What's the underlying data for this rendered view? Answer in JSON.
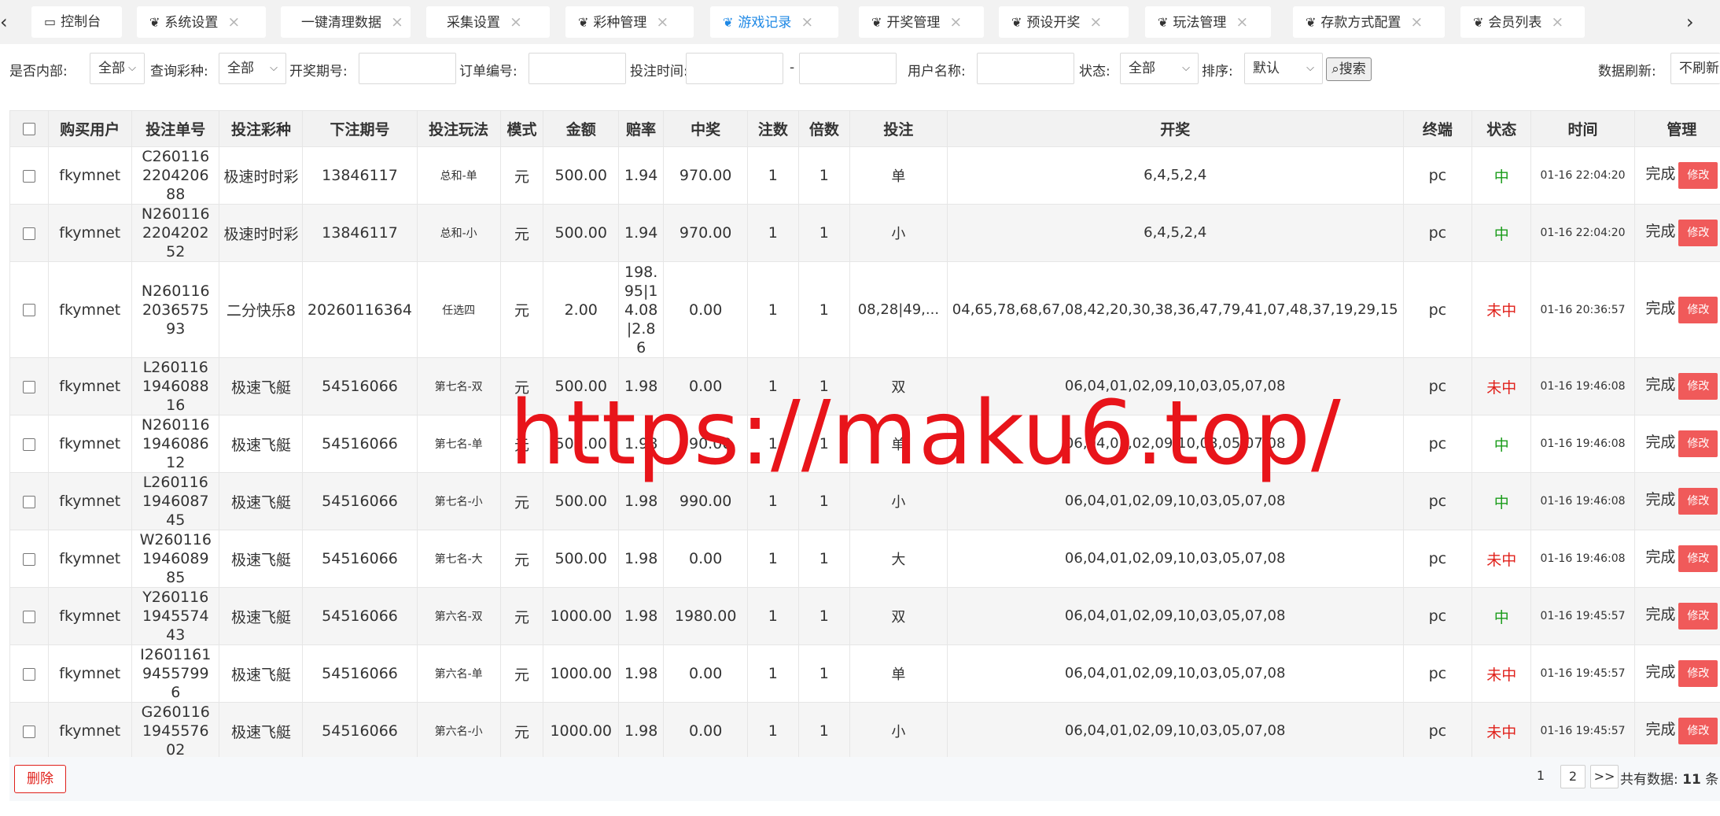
{
  "tabs": [
    {
      "label": "控制台",
      "icon": "monitor-icon",
      "active": false
    },
    {
      "label": "系统设置",
      "icon": "palm-icon",
      "active": false
    },
    {
      "label": "一键清理数据",
      "icon": "",
      "active": false
    },
    {
      "label": "采集设置",
      "icon": "",
      "active": false
    },
    {
      "label": "彩种管理",
      "icon": "palm-icon",
      "active": false
    },
    {
      "label": "游戏记录",
      "icon": "palm-icon",
      "active": true
    },
    {
      "label": "开奖管理",
      "icon": "palm-icon",
      "active": false
    },
    {
      "label": "预设开奖",
      "icon": "palm-icon",
      "active": false
    },
    {
      "label": "玩法管理",
      "icon": "palm-icon",
      "active": false
    },
    {
      "label": "存款方式配置",
      "icon": "palm-icon",
      "active": false
    },
    {
      "label": "会员列表",
      "icon": "palm-icon",
      "active": false
    }
  ],
  "filters": {
    "is_internal_label": "是否内部:",
    "is_internal_value": "全部",
    "lottery_label": "查询彩种:",
    "lottery_value": "全部",
    "period_label": "开奖期号:",
    "order_label": "订单编号:",
    "time_label": "投注时间:",
    "time_sep": "-",
    "user_label": "用户名称:",
    "status_label": "状态:",
    "status_value": "全部",
    "sort_label": "排序:",
    "sort_value": "默认",
    "search_button": "搜索",
    "refresh_label": "数据刷新:",
    "refresh_value": "不刷新"
  },
  "table": {
    "headers": [
      "购买用户",
      "投注单号",
      "投注彩种",
      "下注期号",
      "投注玩法",
      "模式",
      "金额",
      "赔率",
      "中奖",
      "注数",
      "倍数",
      "投注",
      "开奖",
      "终端",
      "状态",
      "时间",
      "管理"
    ],
    "rows": [
      {
        "user": "fkymnet",
        "order": "C260116220420688",
        "lottery": "极速时时彩",
        "period": "13846117",
        "play": "总和-单",
        "mode": "元",
        "amount": "500.00",
        "odds": "1.94",
        "win": "970.00",
        "count": "1",
        "multiple": "1",
        "bet": "单",
        "draw": "6,4,5,2,4",
        "terminal": "pc",
        "status": "中",
        "status_type": "win",
        "time": "01-16 22:04:20",
        "done": "完成",
        "edit": "修改"
      },
      {
        "user": "fkymnet",
        "order": "N260116220420252",
        "lottery": "极速时时彩",
        "period": "13846117",
        "play": "总和-小",
        "mode": "元",
        "amount": "500.00",
        "odds": "1.94",
        "win": "970.00",
        "count": "1",
        "multiple": "1",
        "bet": "小",
        "draw": "6,4,5,2,4",
        "terminal": "pc",
        "status": "中",
        "status_type": "win",
        "time": "01-16 22:04:20",
        "done": "完成",
        "edit": "修改"
      },
      {
        "user": "fkymnet",
        "order": "N260116203657593",
        "lottery": "二分快乐8",
        "period": "20260116364",
        "play": "任选四",
        "mode": "元",
        "amount": "2.00",
        "odds": "198.95|14.08|2.86",
        "win": "0.00",
        "count": "1",
        "multiple": "1",
        "bet": "08,28|49,...",
        "draw": "04,65,78,68,67,08,42,20,30,38,36,47,79,41,07,48,37,19,29,15",
        "terminal": "pc",
        "status": "未中",
        "status_type": "lose",
        "time": "01-16 20:36:57",
        "done": "完成",
        "edit": "修改"
      },
      {
        "user": "fkymnet",
        "order": "L260116194608816",
        "lottery": "极速飞艇",
        "period": "54516066",
        "play": "第七名-双",
        "mode": "元",
        "amount": "500.00",
        "odds": "1.98",
        "win": "0.00",
        "count": "1",
        "multiple": "1",
        "bet": "双",
        "draw": "06,04,01,02,09,10,03,05,07,08",
        "terminal": "pc",
        "status": "未中",
        "status_type": "lose",
        "time": "01-16 19:46:08",
        "done": "完成",
        "edit": "修改"
      },
      {
        "user": "fkymnet",
        "order": "N260116194608612",
        "lottery": "极速飞艇",
        "period": "54516066",
        "play": "第七名-单",
        "mode": "元",
        "amount": "500.00",
        "odds": "1.98",
        "win": "990.00",
        "count": "1",
        "multiple": "1",
        "bet": "单",
        "draw": "06,04,01,02,09,10,03,05,07,08",
        "terminal": "pc",
        "status": "中",
        "status_type": "win",
        "time": "01-16 19:46:08",
        "done": "完成",
        "edit": "修改"
      },
      {
        "user": "fkymnet",
        "order": "L260116194608745",
        "lottery": "极速飞艇",
        "period": "54516066",
        "play": "第七名-小",
        "mode": "元",
        "amount": "500.00",
        "odds": "1.98",
        "win": "990.00",
        "count": "1",
        "multiple": "1",
        "bet": "小",
        "draw": "06,04,01,02,09,10,03,05,07,08",
        "terminal": "pc",
        "status": "中",
        "status_type": "win",
        "time": "01-16 19:46:08",
        "done": "完成",
        "edit": "修改"
      },
      {
        "user": "fkymnet",
        "order": "W260116194608985",
        "lottery": "极速飞艇",
        "period": "54516066",
        "play": "第七名-大",
        "mode": "元",
        "amount": "500.00",
        "odds": "1.98",
        "win": "0.00",
        "count": "1",
        "multiple": "1",
        "bet": "大",
        "draw": "06,04,01,02,09,10,03,05,07,08",
        "terminal": "pc",
        "status": "未中",
        "status_type": "lose",
        "time": "01-16 19:46:08",
        "done": "完成",
        "edit": "修改"
      },
      {
        "user": "fkymnet",
        "order": "Y260116194557443",
        "lottery": "极速飞艇",
        "period": "54516066",
        "play": "第六名-双",
        "mode": "元",
        "amount": "1000.00",
        "odds": "1.98",
        "win": "1980.00",
        "count": "1",
        "multiple": "1",
        "bet": "双",
        "draw": "06,04,01,02,09,10,03,05,07,08",
        "terminal": "pc",
        "status": "中",
        "status_type": "win",
        "time": "01-16 19:45:57",
        "done": "完成",
        "edit": "修改"
      },
      {
        "user": "fkymnet",
        "order": "I260116194557996",
        "lottery": "极速飞艇",
        "period": "54516066",
        "play": "第六名-单",
        "mode": "元",
        "amount": "1000.00",
        "odds": "1.98",
        "win": "0.00",
        "count": "1",
        "multiple": "1",
        "bet": "单",
        "draw": "06,04,01,02,09,10,03,05,07,08",
        "terminal": "pc",
        "status": "未中",
        "status_type": "lose",
        "time": "01-16 19:45:57",
        "done": "完成",
        "edit": "修改"
      },
      {
        "user": "fkymnet",
        "order": "G260116194557602",
        "lottery": "极速飞艇",
        "period": "54516066",
        "play": "第六名-小",
        "mode": "元",
        "amount": "1000.00",
        "odds": "1.98",
        "win": "0.00",
        "count": "1",
        "multiple": "1",
        "bet": "小",
        "draw": "06,04,01,02,09,10,03,05,07,08",
        "terminal": "pc",
        "status": "未中",
        "status_type": "lose",
        "time": "01-16 19:45:57",
        "done": "完成",
        "edit": "修改"
      }
    ]
  },
  "watermark": "https://maku6.top/",
  "footer": {
    "delete_button": "删除",
    "pages": [
      "1",
      "2"
    ],
    "next": ">>",
    "total_label": "共有数据:",
    "total_value": "11",
    "total_unit": "条"
  },
  "colors": {
    "win": "#1a9c1a",
    "lose": "#e0201a",
    "active_tab": "#1e88e5",
    "edit_button": "#f05a5a"
  }
}
